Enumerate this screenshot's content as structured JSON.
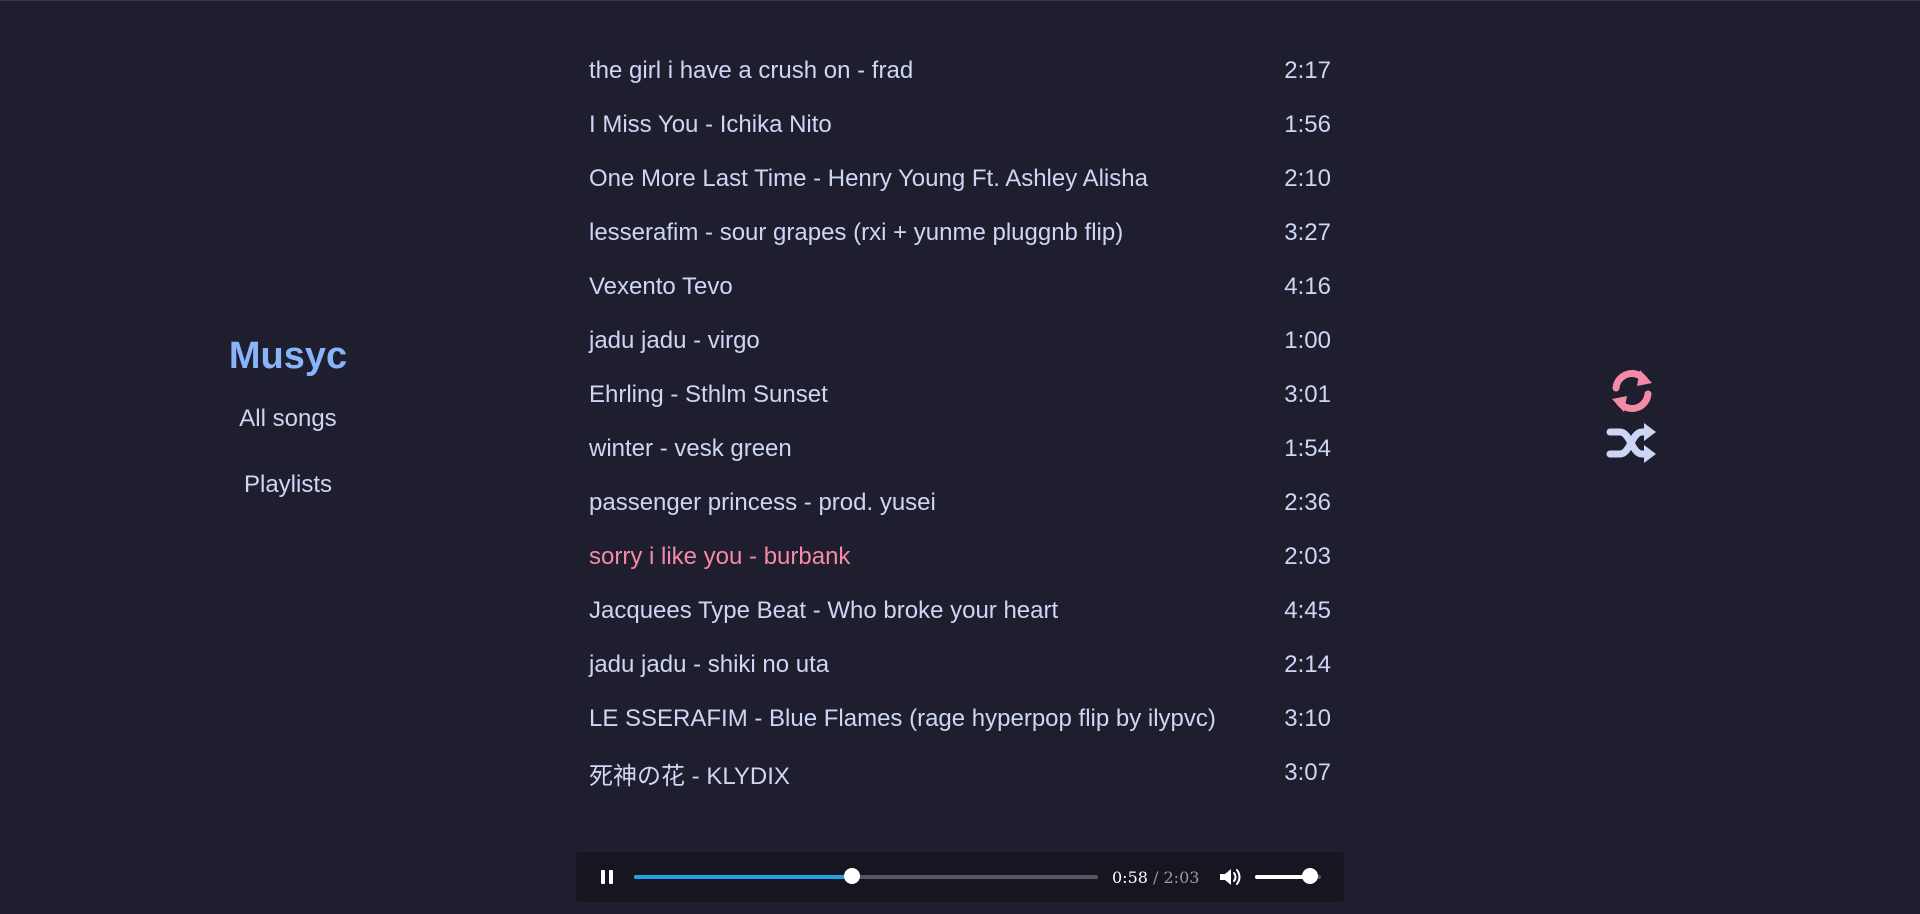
{
  "app": {
    "name": "Musyc"
  },
  "nav": {
    "all_songs": "All songs",
    "playlists": "Playlists"
  },
  "songs": [
    {
      "title": "the girl i have a crush on - frad",
      "duration": "2:17",
      "active": false
    },
    {
      "title": "I Miss You - Ichika Nito",
      "duration": "1:56",
      "active": false
    },
    {
      "title": "One More Last Time - Henry Young Ft. Ashley Alisha",
      "duration": "2:10",
      "active": false
    },
    {
      "title": "lesserafim - sour grapes (rxi + yunme pluggnb flip)",
      "duration": "3:27",
      "active": false
    },
    {
      "title": "Vexento Tevo",
      "duration": "4:16",
      "active": false
    },
    {
      "title": "jadu jadu - virgo",
      "duration": "1:00",
      "active": false
    },
    {
      "title": "Ehrling - Sthlm Sunset",
      "duration": "3:01",
      "active": false
    },
    {
      "title": "winter - vesk green",
      "duration": "1:54",
      "active": false
    },
    {
      "title": "passenger princess - prod. yusei",
      "duration": "2:36",
      "active": false
    },
    {
      "title": "sorry i like you - burbank",
      "duration": "2:03",
      "active": true
    },
    {
      "title": "Jacquees Type Beat - Who broke your heart",
      "duration": "4:45",
      "active": false
    },
    {
      "title": "jadu jadu - shiki no uta",
      "duration": "2:14",
      "active": false
    },
    {
      "title": "LE SSERAFIM - Blue Flames (rage hyperpop flip by ilypvc)",
      "duration": "3:10",
      "active": false
    },
    {
      "title": "死神の花 - KLYDIX",
      "duration": "3:07",
      "active": false
    }
  ],
  "controls": {
    "repeat_icon": "repeat-icon",
    "shuffle_icon": "shuffle-icon"
  },
  "player": {
    "state": "playing",
    "current_time": "0:58",
    "separator": " / ",
    "total_time": "2:03",
    "progress": 0.47,
    "volume": 0.83
  },
  "colors": {
    "background": "#1e1e2e",
    "accent": "#89b4fa",
    "active": "#f38ba8",
    "text": "#cdd6f4",
    "progress": "#1fa2e0"
  }
}
